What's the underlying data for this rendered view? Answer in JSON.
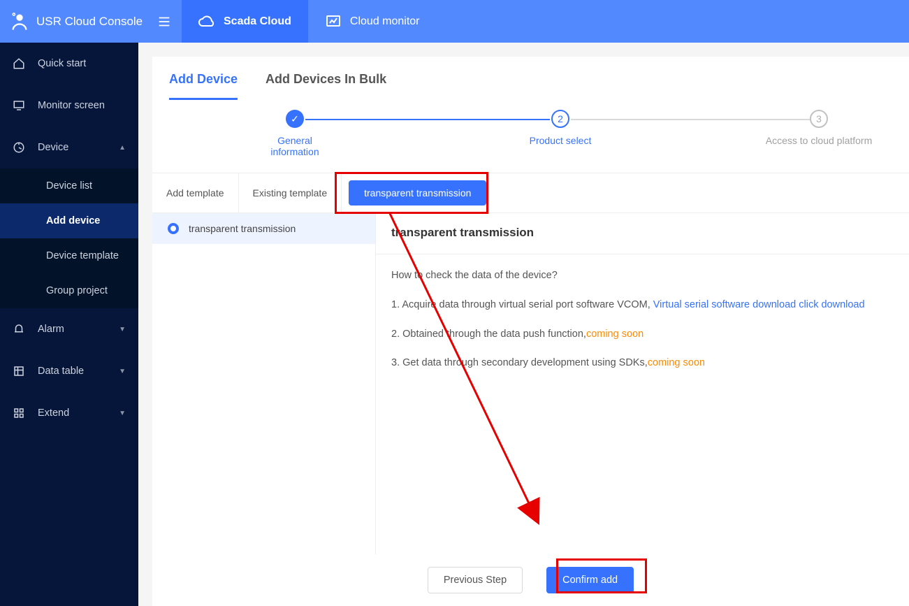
{
  "topbar": {
    "brand": "USR Cloud Console",
    "tabs": [
      {
        "label": "Scada Cloud",
        "active": true
      },
      {
        "label": "Cloud monitor",
        "active": false
      }
    ]
  },
  "sidebar": {
    "items": [
      {
        "icon": "home",
        "label": "Quick start",
        "type": "item"
      },
      {
        "icon": "monitor",
        "label": "Monitor screen",
        "type": "item"
      },
      {
        "icon": "device",
        "label": "Device",
        "type": "group",
        "expanded": true,
        "children": [
          {
            "label": "Device list"
          },
          {
            "label": "Add device",
            "active": true
          },
          {
            "label": "Device template"
          },
          {
            "label": "Group project"
          }
        ]
      },
      {
        "icon": "alarm",
        "label": "Alarm",
        "type": "group"
      },
      {
        "icon": "table",
        "label": "Data table",
        "type": "group"
      },
      {
        "icon": "extend",
        "label": "Extend",
        "type": "group"
      }
    ]
  },
  "pageTabs": {
    "add": "Add Device",
    "bulk": "Add Devices In Bulk"
  },
  "steps": {
    "s1": "General information",
    "s2": "Product select",
    "s3": "Access to cloud platform"
  },
  "tplTabs": {
    "add": "Add template",
    "existing": "Existing template",
    "transparent": "transparent transmission"
  },
  "option": {
    "transparent": "transparent transmission"
  },
  "info": {
    "title": "transparent transmission",
    "q": "How to check the data of the device?",
    "l1a": "1. Acquire data through virtual serial port software VCOM, ",
    "l1link": "Virtual serial software download click download",
    "l2a": "2. Obtained through the data push function,",
    "l2soon": "coming soon",
    "l3a": "3. Get data through secondary development using SDKs,",
    "l3soon": "coming soon"
  },
  "footer": {
    "prev": "Previous Step",
    "confirm": "Confirm add"
  }
}
